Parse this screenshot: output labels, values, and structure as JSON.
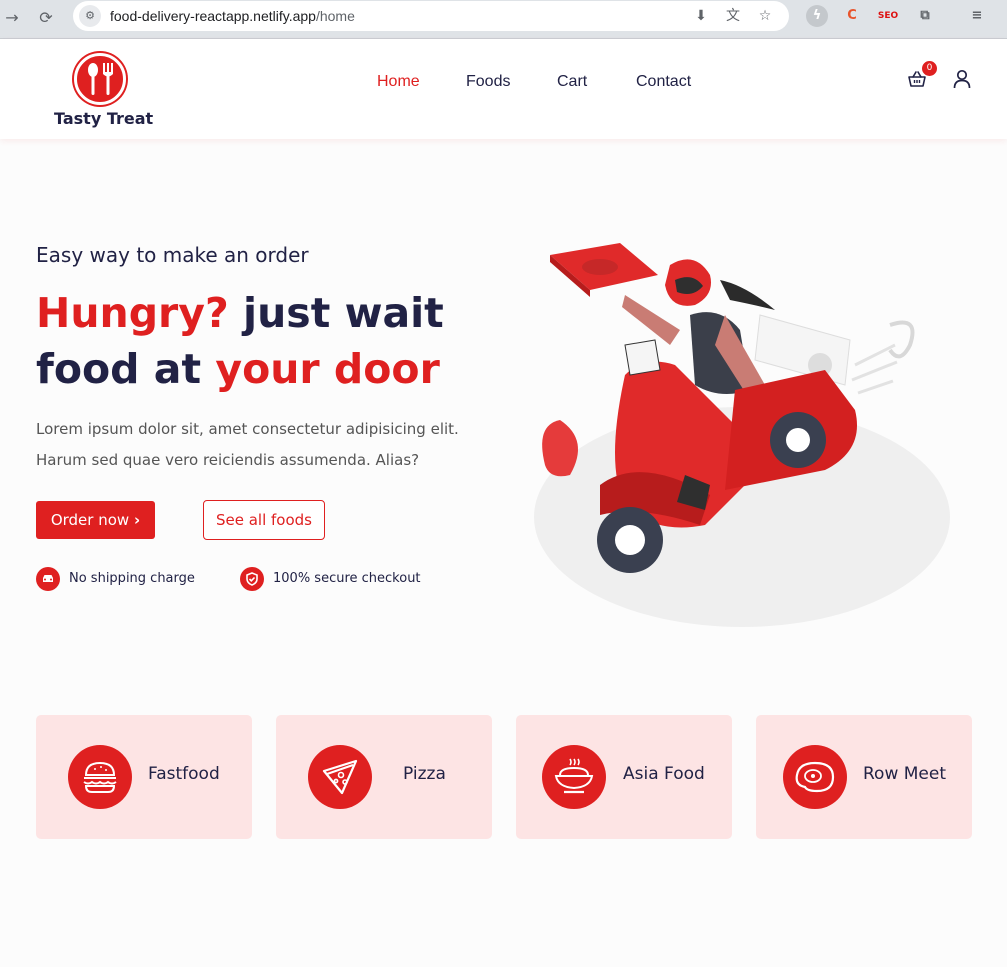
{
  "browser": {
    "url_host": "food-delivery-reactapp.netlify.app",
    "url_path": "/home"
  },
  "header": {
    "logo_text": "Tasty Treat",
    "nav": [
      {
        "label": "Home",
        "active": true
      },
      {
        "label": "Foods",
        "active": false
      },
      {
        "label": "Cart",
        "active": false
      },
      {
        "label": "Contact",
        "active": false
      }
    ],
    "cart_count": "0",
    "icons": {
      "cart": "shopping-basket-icon",
      "user": "user-icon"
    }
  },
  "hero": {
    "subtitle": "Easy way to make an order",
    "title_part1": "Hungry?",
    "title_part2": " just wait",
    "title_part3": "food at ",
    "title_part4": "your door",
    "description": "Lorem ipsum dolor sit, amet consectetur adipisicing elit. Harum sed quae vero reiciendis assumenda. Alias?",
    "order_button": "Order now",
    "order_button_icon": "›",
    "all_foods_button": "See all foods",
    "perks": [
      {
        "label": "No shipping charge",
        "icon": "car-icon"
      },
      {
        "label": "100% secure checkout",
        "icon": "shield-check-icon"
      }
    ]
  },
  "categories": [
    {
      "label": "Fastfood",
      "icon": "burger-icon"
    },
    {
      "label": "Pizza",
      "icon": "pizza-slice-icon"
    },
    {
      "label": "Asia Food",
      "icon": "rice-bowl-icon"
    },
    {
      "label": "Row Meet",
      "icon": "steak-icon"
    }
  ],
  "colors": {
    "accent": "#df2020",
    "text_dark": "#212245",
    "category_bg": "#fde4e4"
  }
}
